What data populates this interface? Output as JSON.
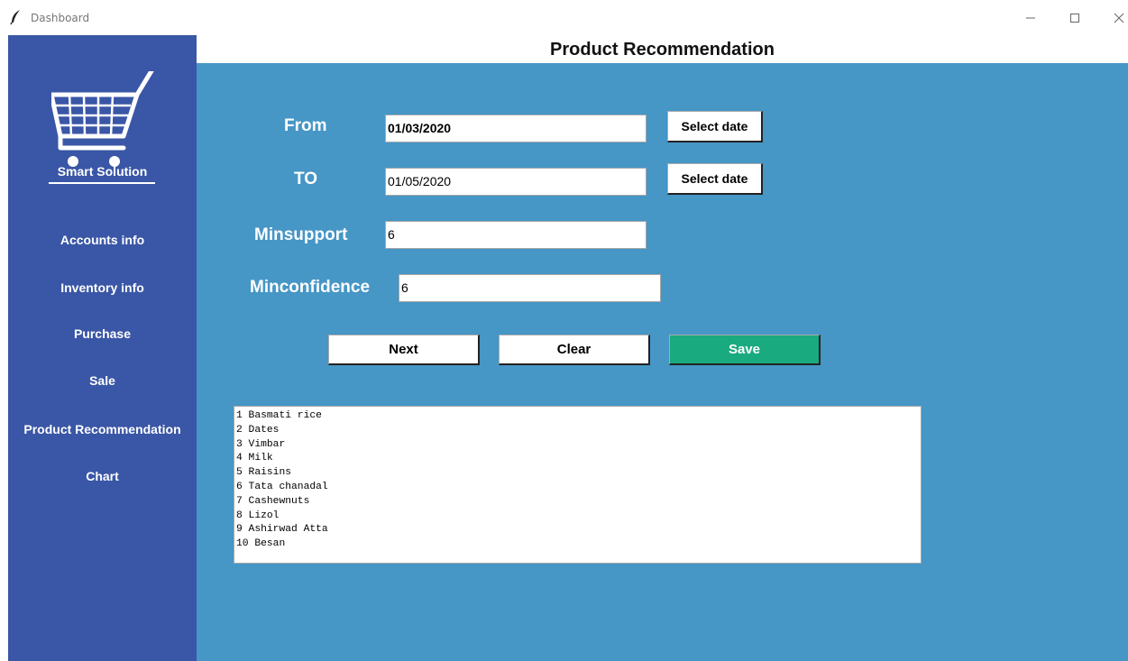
{
  "window": {
    "title": "Dashboard",
    "icon": "feather-icon"
  },
  "sidebar": {
    "brand": "Smart Solution",
    "logo_icon": "shopping-cart-icon",
    "items": [
      {
        "label": "Accounts info"
      },
      {
        "label": "Inventory info"
      },
      {
        "label": "Purchase"
      },
      {
        "label": "Sale"
      },
      {
        "label": "Product Recommendation"
      },
      {
        "label": "Chart"
      }
    ]
  },
  "header": {
    "title": "Product Recommendation"
  },
  "form": {
    "from_label": "From",
    "from_value": "01/03/2020",
    "to_label": "TO",
    "to_value": "01/05/2020",
    "select_date_label": "Select date",
    "minsupport_label": "Minsupport",
    "minsupport_value": "6",
    "minconfidence_label": "Minconfidence",
    "minconfidence_value": "6"
  },
  "buttons": {
    "next": "Next",
    "clear": "Clear",
    "save": "Save"
  },
  "results": [
    "1 Basmati rice",
    "2 Dates",
    "3 Vimbar",
    "4 Milk",
    "5 Raisins",
    "6 Tata chanadal",
    "7 Cashewnuts",
    "8 Lizol",
    "9 Ashirwad Atta",
    "10 Besan"
  ],
  "colors": {
    "sidebar": "#3a56a6",
    "main": "#4696c6",
    "save_button": "#1aaa7f"
  }
}
